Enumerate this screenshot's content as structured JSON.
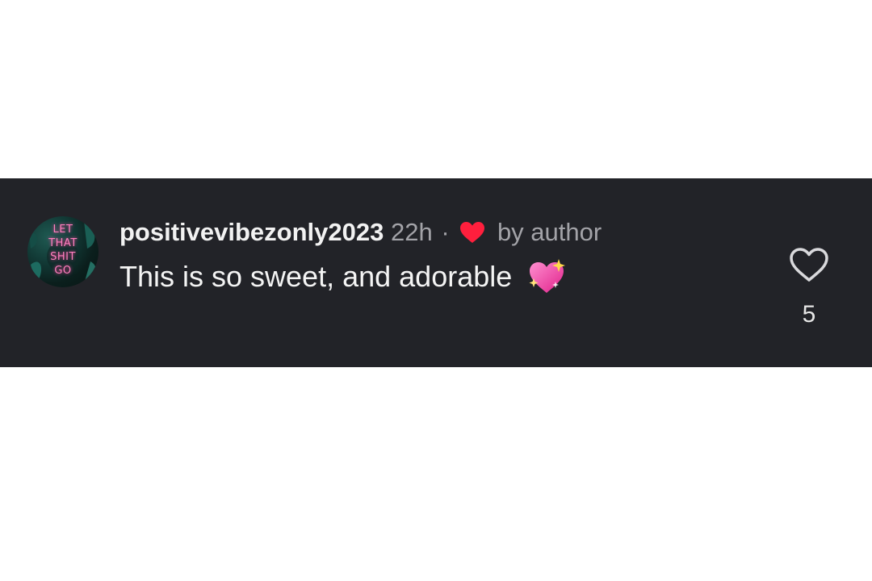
{
  "comment": {
    "username": "positivevibezonly2023",
    "time": "22h",
    "separator": "·",
    "author_like_label": "by author",
    "text": "This is so sweet, and adorable",
    "like_count": "5"
  },
  "avatar": {
    "lines": [
      "LET",
      "THAT",
      "SHIT",
      "GO"
    ]
  },
  "icons": {
    "author_heart": "red-heart-icon",
    "emoji": "sparkling-heart-emoji",
    "like": "heart-outline-icon"
  },
  "colors": {
    "band_background": "#222328",
    "page_background": "#ffffff",
    "username": "#f2f2f2",
    "meta": "#a3a3a8",
    "author_heart": "#ff1f3d",
    "avatar_neon": "#ff7fbf"
  }
}
